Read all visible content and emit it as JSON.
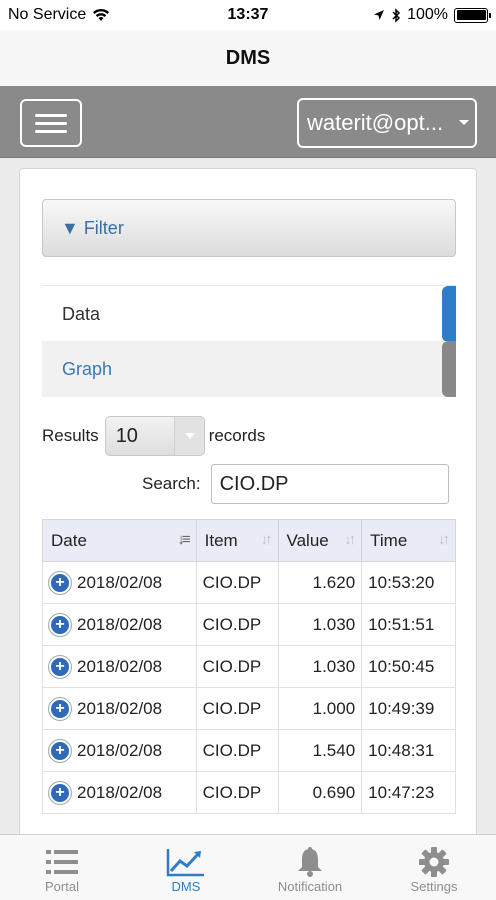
{
  "status_bar": {
    "carrier": "No Service",
    "time": "13:37",
    "battery": "100%"
  },
  "nav": {
    "title": "DMS"
  },
  "toolbar": {
    "account": "waterit@opt..."
  },
  "filter": {
    "label": "▼ Filter"
  },
  "view_tabs": [
    {
      "label": "Data"
    },
    {
      "label": "Graph"
    }
  ],
  "results": {
    "prefix": "Results",
    "page_size": "10",
    "suffix": "records"
  },
  "search": {
    "label": "Search:",
    "value": "CIO.DP"
  },
  "table": {
    "columns": [
      "Date",
      "Item",
      "Value",
      "Time"
    ],
    "rows": [
      {
        "date": "2018/02/08",
        "item": "CIO.DP",
        "value": "1.620",
        "time": "10:53:20"
      },
      {
        "date": "2018/02/08",
        "item": "CIO.DP",
        "value": "1.030",
        "time": "10:51:51"
      },
      {
        "date": "2018/02/08",
        "item": "CIO.DP",
        "value": "1.030",
        "time": "10:50:45"
      },
      {
        "date": "2018/02/08",
        "item": "CIO.DP",
        "value": "1.000",
        "time": "10:49:39"
      },
      {
        "date": "2018/02/08",
        "item": "CIO.DP",
        "value": "1.540",
        "time": "10:48:31"
      },
      {
        "date": "2018/02/08",
        "item": "CIO.DP",
        "value": "0.690",
        "time": "10:47:23"
      }
    ]
  },
  "tabbar": [
    {
      "label": "Portal",
      "icon": "list-icon"
    },
    {
      "label": "DMS",
      "icon": "chart-icon",
      "active": true
    },
    {
      "label": "Notification",
      "icon": "bell-icon"
    },
    {
      "label": "Settings",
      "icon": "gear-icon"
    }
  ],
  "colors": {
    "accent": "#2f7dc4",
    "toolbar": "#8a8a8a",
    "header_row": "#e9ecf6"
  }
}
